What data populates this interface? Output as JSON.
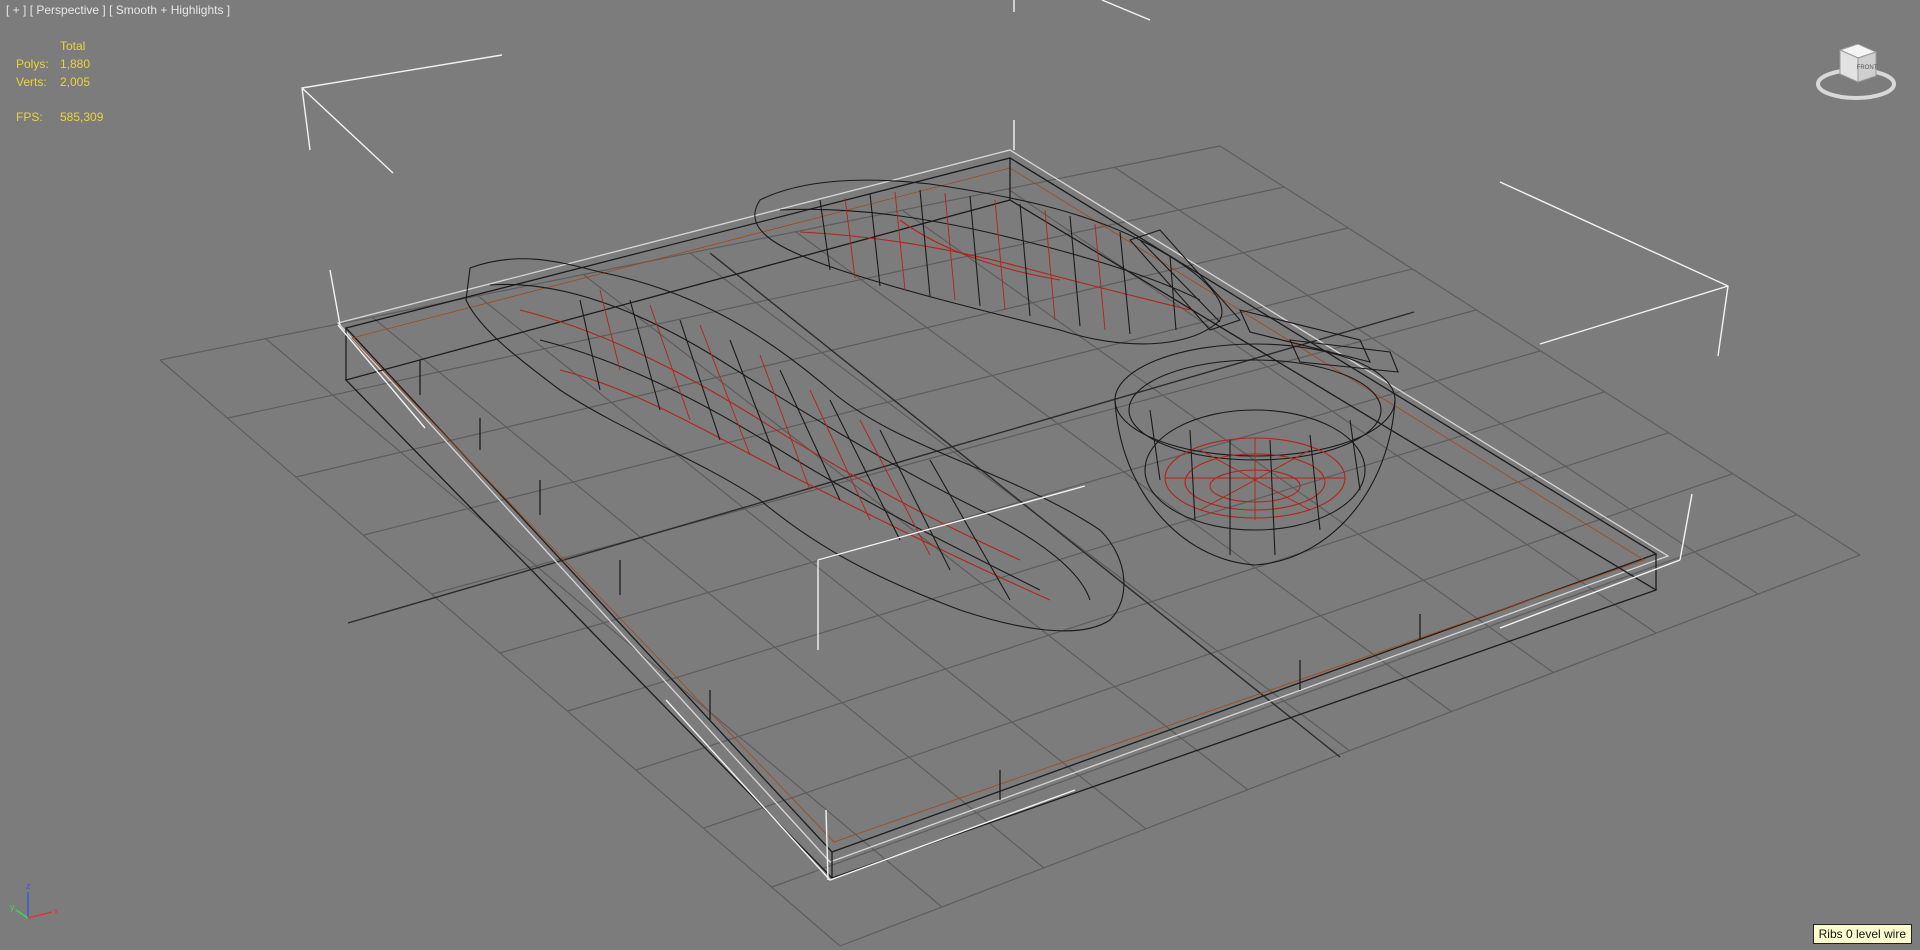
{
  "viewport": {
    "label_parts": [
      "[ + ]",
      "[ Perspective ]",
      "[ Smooth + Highlights ]"
    ],
    "stats": {
      "header": "Total",
      "rows": [
        {
          "key": "Polys:",
          "value": "1,880"
        },
        {
          "key": "Verts:",
          "value": "2,005"
        }
      ],
      "fps_key": "FPS:",
      "fps_value": "585,309"
    },
    "viewcube_label": "FRONT",
    "status_text": "Ribs 0 level wire",
    "axis_labels": {
      "x": "x",
      "y": "y",
      "z": "z"
    }
  },
  "colors": {
    "background": "#7c7c7c",
    "grid": "#5a5a5a",
    "wire_dark": "#1a1a1a",
    "wire_red": "#b32418",
    "selection_bracket": "#f0f0f0",
    "stats_text": "#e8d43a"
  }
}
